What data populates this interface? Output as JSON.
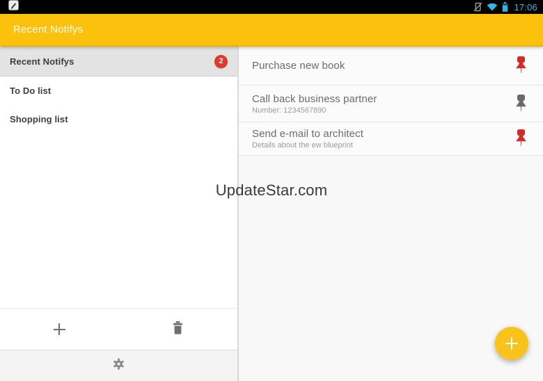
{
  "status_bar": {
    "time": "17:06",
    "time_color": "#33B5E5",
    "icons": [
      "note-notification-icon",
      "vibrate-icon",
      "wifi-icon",
      "battery-icon"
    ]
  },
  "action_bar": {
    "title": "Recent Notifys",
    "color": "#FCC10D"
  },
  "sidebar": {
    "items": [
      {
        "label": "Recent Notifys",
        "badge": "2",
        "selected": true
      },
      {
        "label": "To Do list",
        "selected": false
      },
      {
        "label": "Shopping list",
        "selected": false
      }
    ],
    "badge_color": "#E0392E",
    "toolbar": {
      "add_icon": "plus-icon",
      "delete_icon": "trash-icon"
    },
    "settings_icon": "gear-icon"
  },
  "main": {
    "items": [
      {
        "title": "Purchase new book",
        "subtitle": "",
        "pin_icon": "pushpin-icon",
        "pin_color": "#CE2E27"
      },
      {
        "title": "Call back business partner",
        "subtitle": "Number: 1234567890",
        "pin_icon": "pushpin-icon",
        "pin_color": "#6A6A6A"
      },
      {
        "title": "Send e-mail to architect",
        "subtitle": "Details about the ew blueprint",
        "pin_icon": "pushpin-icon",
        "pin_color": "#CE2E27"
      }
    ],
    "fab": {
      "icon": "plus-icon",
      "color": "#F7C31C"
    }
  },
  "watermark": "UpdateStar.com"
}
